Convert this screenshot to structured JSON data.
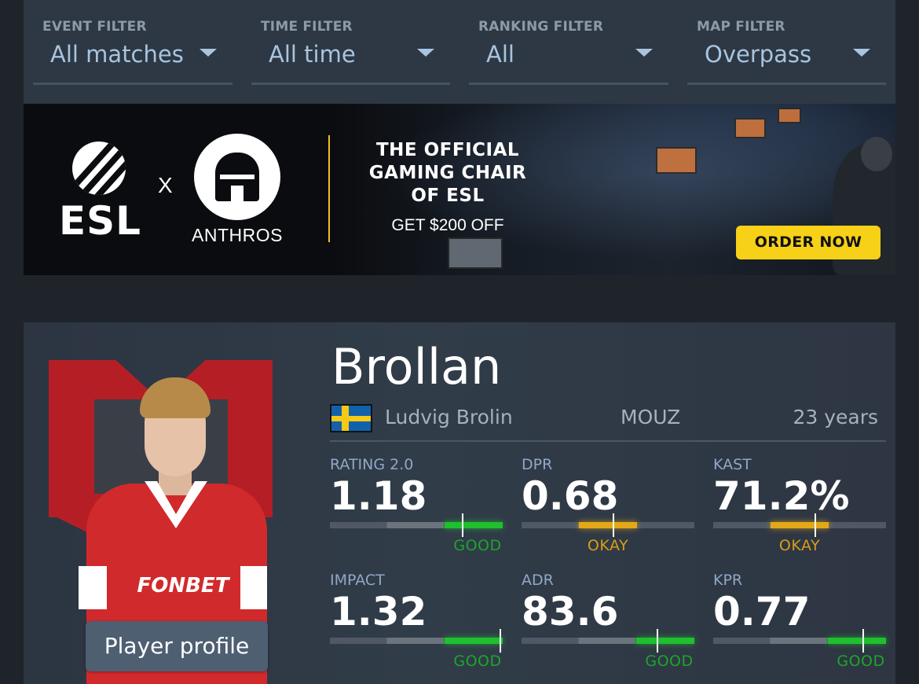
{
  "filters": [
    {
      "label": "EVENT FILTER",
      "value": "All matches"
    },
    {
      "label": "TIME FILTER",
      "value": "All time"
    },
    {
      "label": "RANKING FILTER",
      "value": "All"
    },
    {
      "label": "MAP FILTER",
      "value": "Overpass"
    }
  ],
  "banner": {
    "brand_left": "ESL",
    "separator": "X",
    "brand_right": "ANTHROS",
    "headline": "THE OFFICIAL GAMING CHAIR OF ESL",
    "offer": "GET $200 OFF",
    "cta": "ORDER NOW",
    "accent_color": "#f7d117"
  },
  "player": {
    "nickname": "Brollan",
    "real_name": "Ludvig Brolin",
    "country_flag": "sweden-flag-icon",
    "team": "MOUZ",
    "age": "23 years",
    "shirt_sponsor": "FONBET",
    "profile_button": "Player profile"
  },
  "stats": [
    {
      "label": "RATING 2.0",
      "value": "1.18",
      "verdict": "GOOD",
      "level": 0.77
    },
    {
      "label": "DPR",
      "value": "0.68",
      "verdict": "OKAY",
      "level": 0.53
    },
    {
      "label": "KAST",
      "value": "71.2%",
      "verdict": "OKAY",
      "level": 0.59
    },
    {
      "label": "IMPACT",
      "value": "1.32",
      "verdict": "GOOD",
      "level": 0.99
    },
    {
      "label": "ADR",
      "value": "83.6",
      "verdict": "GOOD",
      "level": 0.79
    },
    {
      "label": "KPR",
      "value": "0.77",
      "verdict": "GOOD",
      "level": 0.87
    }
  ],
  "colors": {
    "good": "#1fbf2f",
    "okay": "#e3a817",
    "filter_value": "#a8c4e0"
  }
}
